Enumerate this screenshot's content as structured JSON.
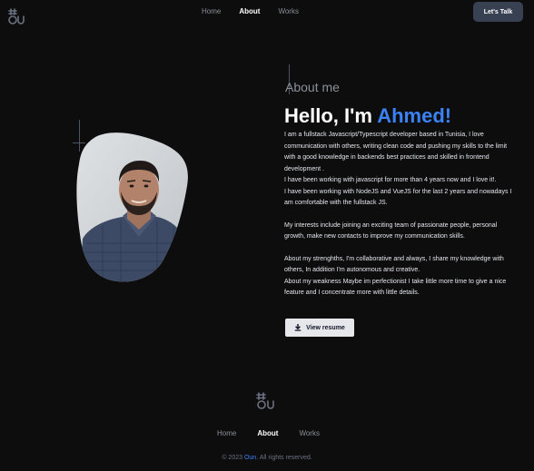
{
  "header": {
    "nav": [
      {
        "label": "Home",
        "active": false
      },
      {
        "label": "About",
        "active": true
      },
      {
        "label": "Works",
        "active": false
      }
    ],
    "cta_label": "Let's Talk"
  },
  "about": {
    "section_label": "About me",
    "greeting": "Hello, I'm",
    "name": "Ahmed!",
    "paragraphs": [
      "I am a fullstack Javascript/Typescript developer based in Tunisia, I love communication with others, writing clean code and pushing my skills to the limit with a good knowledge in backends best practices and skilled in frontend development .",
      "I have been working with javascript for more than 4 years now and I love it!.",
      "I have been working with NodeJS and VueJS for the last 2 years and nowadays I am comfortable with the fullstack JS.",
      "My interests include joining an exciting team of passionate people, personal growth, make new contacts to improve my communication skills.",
      "About my strenghths, I'm collaborative and always, I share my knowledge with others, In addition I'm autonomous and creative.",
      "About my weakness Maybe im perfectionist I take little more time to give a nice feature and I concentrate more with little details."
    ],
    "resume_label": "View resume",
    "resume_icon": "download-icon"
  },
  "footer": {
    "nav": [
      {
        "label": "Home",
        "active": false
      },
      {
        "label": "About",
        "active": true
      },
      {
        "label": "Works",
        "active": false
      }
    ],
    "copyright_prefix": "© 2023",
    "brand": "Oun",
    "copyright_suffix": ". All rights reserved."
  },
  "colors": {
    "background": "#0d0d0e",
    "accent": "#3b82f6",
    "button_dark": "#374151",
    "button_light": "#e5e7eb"
  }
}
